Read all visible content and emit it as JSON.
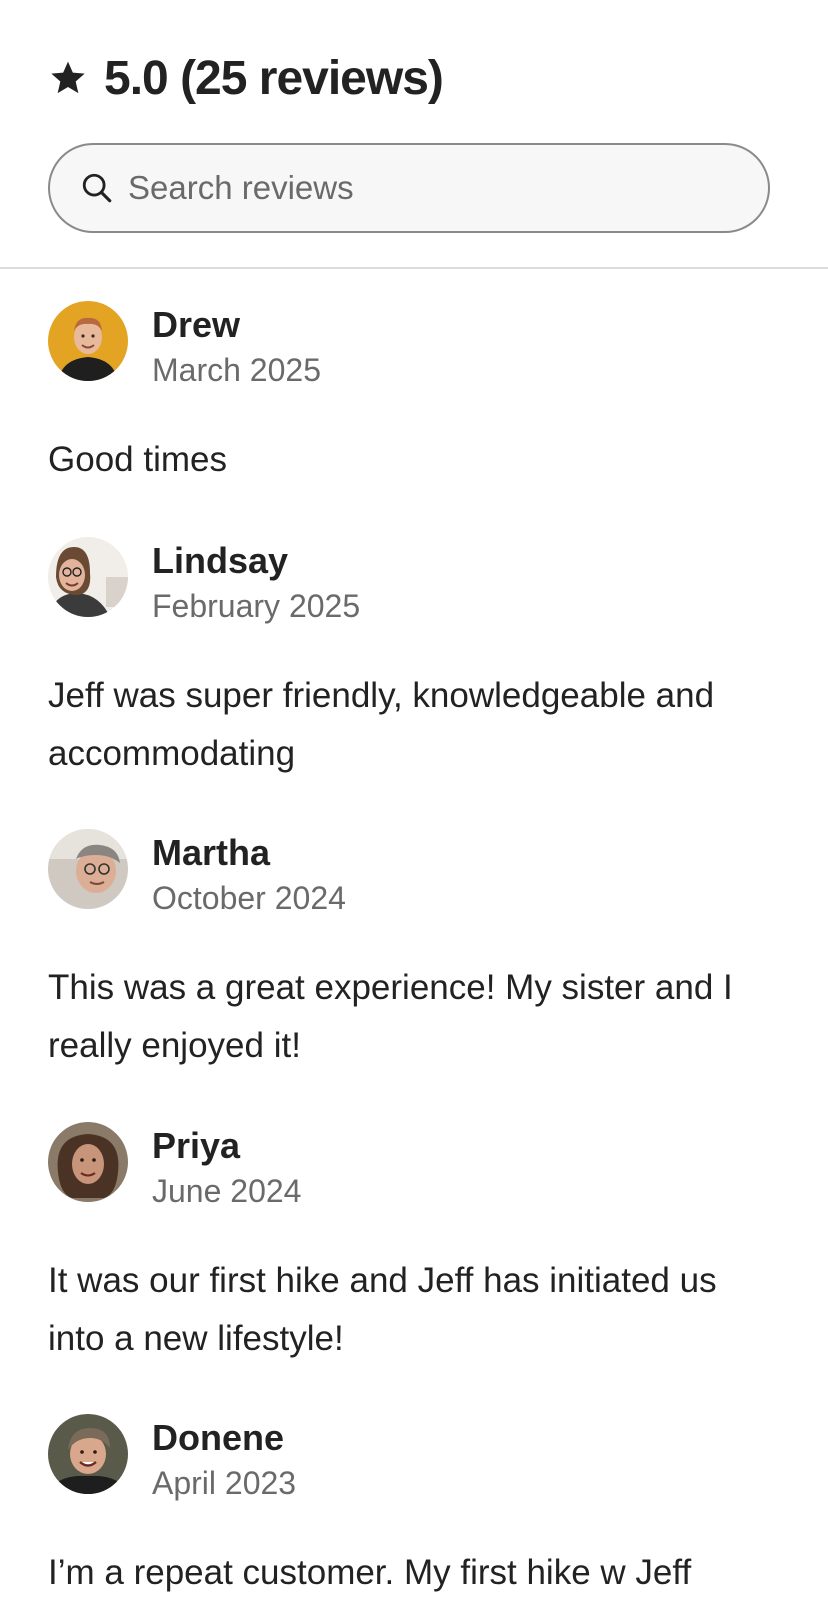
{
  "header": {
    "rating": "5.0 (25 reviews)",
    "icon": "star-icon"
  },
  "search": {
    "placeholder": "Search reviews",
    "icon": "search-icon"
  },
  "reviews": [
    {
      "name": "Drew",
      "date": "March 2025",
      "text": "Good times"
    },
    {
      "name": "Lindsay",
      "date": "February 2025",
      "text": "Jeff was super friendly, knowledgeable and accommodating"
    },
    {
      "name": "Martha",
      "date": "October 2024",
      "text": "This was a great experience! My sister and I really enjoyed it!"
    },
    {
      "name": "Priya",
      "date": "June 2024",
      "text": "It was our first hike and Jeff has initiated us into a new lifestyle!"
    },
    {
      "name": "Donene",
      "date": "April 2023",
      "text": "I’m a repeat customer. My first hike w Jeff"
    }
  ]
}
